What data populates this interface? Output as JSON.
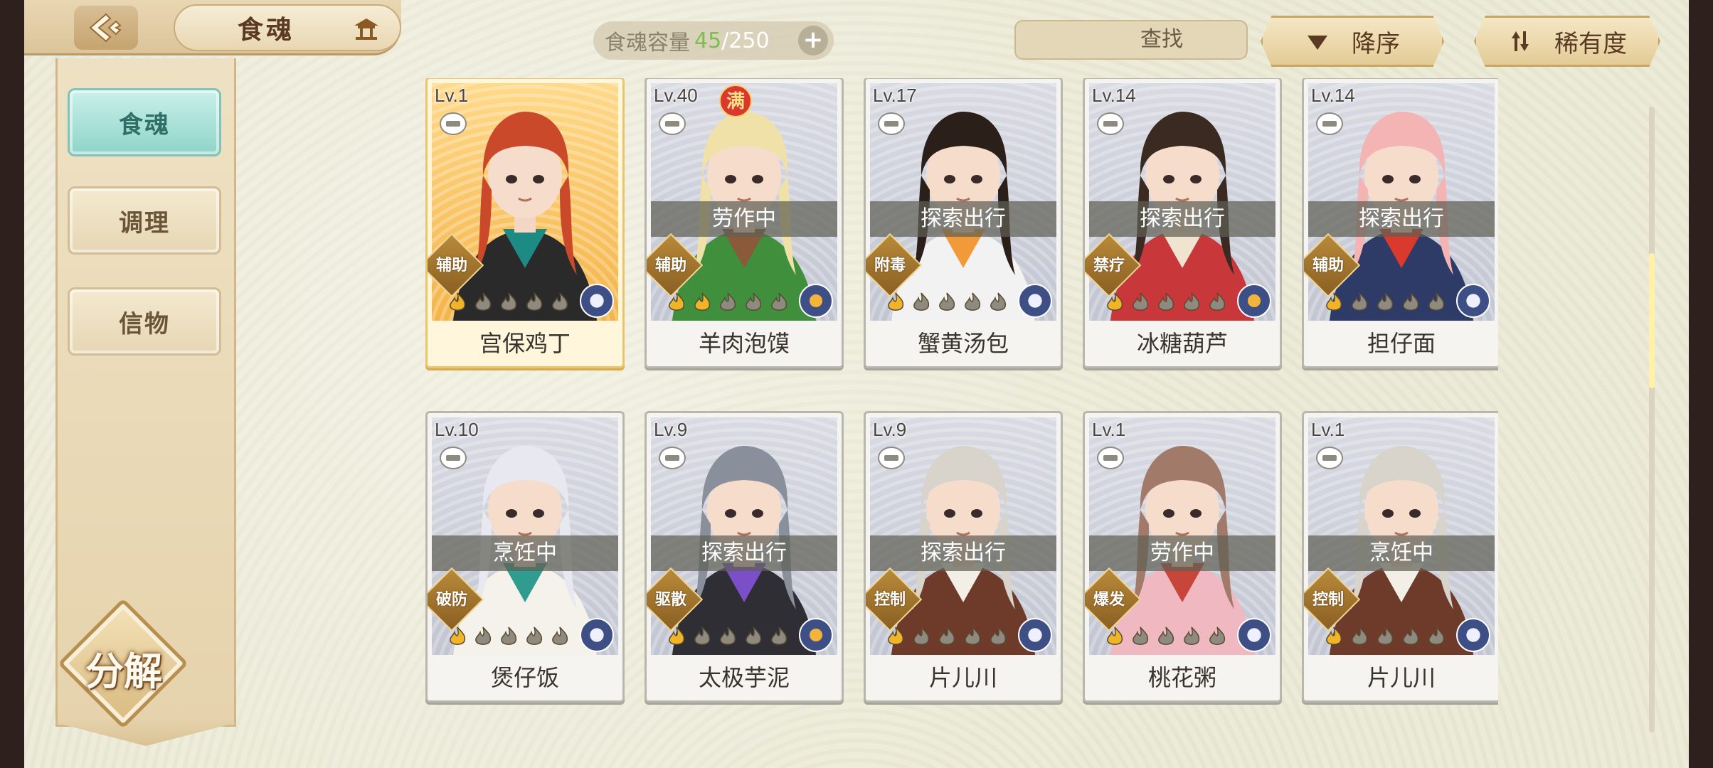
{
  "header": {
    "title": "食魂",
    "capacity_label": "食魂容量",
    "capacity_current": "45",
    "capacity_separator": "/",
    "capacity_max": "250",
    "plus_label": "+",
    "search_placeholder": "查找",
    "sort_order_label": "降序",
    "sort_key_label": "稀有度"
  },
  "sidebar": {
    "tabs": [
      {
        "label": "食魂",
        "active": true
      },
      {
        "label": "调理",
        "active": false
      },
      {
        "label": "信物",
        "active": false
      }
    ],
    "decompose_label": "分解"
  },
  "cards": [
    {
      "level": "Lv.1",
      "name": "宫保鸡丁",
      "status": "",
      "role": "辅助",
      "stars_filled": 1,
      "full": false,
      "gold": true,
      "hair": "#c9492a",
      "outfit": "#2a2a2a",
      "accent": "#1e8a84",
      "element": "flower"
    },
    {
      "level": "Lv.40",
      "name": "羊肉泡馍",
      "status": "劳作中",
      "role": "辅助",
      "stars_filled": 2,
      "full": true,
      "full_label": "满",
      "gold": false,
      "hair": "#efe1a8",
      "outfit": "#3f8f3c",
      "accent": "#8a5a3a",
      "element": "gold"
    },
    {
      "level": "Lv.17",
      "name": "蟹黄汤包",
      "status": "探索出行",
      "role": "附毒",
      "stars_filled": 1,
      "full": false,
      "gold": false,
      "hair": "#2b1f1a",
      "outfit": "#f2f2f2",
      "accent": "#f29a3a",
      "element": "flower"
    },
    {
      "level": "Lv.14",
      "name": "冰糖葫芦",
      "status": "探索出行",
      "role": "禁疗",
      "stars_filled": 1,
      "full": false,
      "gold": false,
      "hair": "#3a2a22",
      "outfit": "#c8373a",
      "accent": "#f0e4d0",
      "element": "gold"
    },
    {
      "level": "Lv.14",
      "name": "担仔面",
      "status": "探索出行",
      "role": "辅助",
      "stars_filled": 1,
      "full": false,
      "gold": false,
      "hair": "#f4b4b4",
      "outfit": "#2e3b66",
      "accent": "#d93a2c",
      "element": "flower"
    },
    {
      "level": "Lv.10",
      "name": "煲仔饭",
      "status": "烹饪中",
      "role": "破防",
      "stars_filled": 1,
      "full": false,
      "gold": false,
      "hair": "#e8e8f0",
      "outfit": "#f4f2ea",
      "accent": "#2f9c8f",
      "element": "flower"
    },
    {
      "level": "Lv.9",
      "name": "太极芋泥",
      "status": "探索出行",
      "role": "驱散",
      "stars_filled": 1,
      "full": false,
      "gold": false,
      "hair": "#8a8f9c",
      "outfit": "#2e2e34",
      "accent": "#7a4fc7",
      "element": "gold"
    },
    {
      "level": "Lv.9",
      "name": "片儿川",
      "status": "探索出行",
      "role": "控制",
      "stars_filled": 1,
      "full": false,
      "gold": false,
      "hair": "#d8d4cc",
      "outfit": "#6e3a2a",
      "accent": "#f4efe6",
      "element": "flower"
    },
    {
      "level": "Lv.1",
      "name": "桃花粥",
      "status": "劳作中",
      "role": "爆发",
      "stars_filled": 1,
      "full": false,
      "gold": false,
      "hair": "#a27a6a",
      "outfit": "#f0b8c0",
      "accent": "#c6473a",
      "element": "flower"
    },
    {
      "level": "Lv.1",
      "name": "片儿川",
      "status": "烹饪中",
      "role": "控制",
      "stars_filled": 1,
      "full": false,
      "gold": false,
      "hair": "#d8d4cc",
      "outfit": "#6e3a2a",
      "accent": "#f4efe6",
      "element": "flower"
    }
  ],
  "icons": {
    "back": "back-arrow-icon",
    "pavilion": "pavilion-icon",
    "search": "search-icon",
    "clear": "close-icon",
    "sort_desc": "triangle-down-icon",
    "sort_key": "sort-arrows-icon",
    "lock": "lock-icon",
    "star": "flame-star-icon",
    "element": "element-icon"
  },
  "colors": {
    "accent_green": "#7cbf4f",
    "active_tab": "#8fd4c8",
    "gold_card": "#e9c56c",
    "status_overlay": "#606054"
  }
}
